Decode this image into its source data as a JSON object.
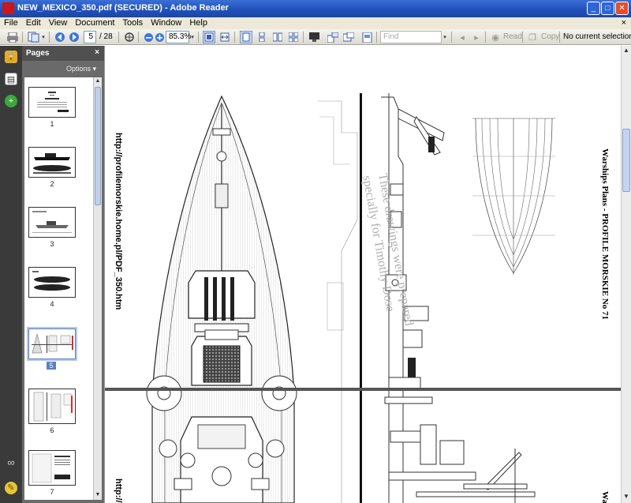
{
  "window": {
    "title": "NEW_MEXICO_350.pdf (SECURED) - Adobe Reader",
    "controls": [
      "_",
      "□",
      "✕"
    ]
  },
  "menu": {
    "items": [
      "File",
      "Edit",
      "View",
      "Document",
      "Tools",
      "Window",
      "Help"
    ],
    "close_doc": "×"
  },
  "toolbar": {
    "page_current": "5",
    "page_total": "/ 28",
    "zoom": "85.3%",
    "find_placeholder": "Find",
    "read_label": "Read",
    "copy_label": "Copy",
    "selection_status": "No current selection"
  },
  "pages_panel": {
    "title": "Pages",
    "close": "×",
    "options_label": "Options ▾",
    "thumbnails": [
      {
        "label": "1",
        "selected": false
      },
      {
        "label": "2",
        "selected": false
      },
      {
        "label": "3",
        "selected": false
      },
      {
        "label": "4",
        "selected": false
      },
      {
        "label": "5",
        "selected": true
      },
      {
        "label": "6",
        "selected": false
      },
      {
        "label": "7",
        "selected": false
      }
    ]
  },
  "document": {
    "url_text": "http://profilemorskie.home.pl/PDF_350.htm",
    "url_text_partial": "http://",
    "right_caption": "Warships Plans - PROFILE MORSKIE No 71",
    "right_caption_partial": "Wa",
    "watermark_line1": "These drawings were prepared",
    "watermark_line2": "specially for Timothy Dose"
  },
  "colors": {
    "titlebar": "#245edb",
    "panel_dark": "#3a3a3a",
    "panel_gray": "#6a6a6a",
    "selection_blue": "#5a7fc6"
  }
}
